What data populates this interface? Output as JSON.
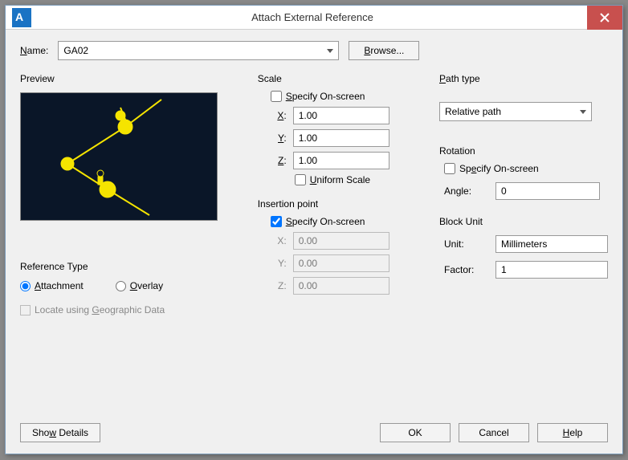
{
  "window": {
    "title": "Attach External Reference"
  },
  "name": {
    "label": "Name:",
    "value": "GA02",
    "browse": "Browse..."
  },
  "preview": {
    "title": "Preview"
  },
  "reference_type": {
    "title": "Reference Type",
    "attachment": "Attachment",
    "overlay": "Overlay"
  },
  "locate_geo": "Locate using Geographic Data",
  "scale": {
    "title": "Scale",
    "specify": "Specify On-screen",
    "x_label": "X:",
    "x": "1.00",
    "y_label": "Y:",
    "y": "1.00",
    "z_label": "Z:",
    "z": "1.00",
    "uniform": "Uniform Scale"
  },
  "insertion": {
    "title": "Insertion point",
    "specify": "Specify On-screen",
    "x_label": "X:",
    "x": "0.00",
    "y_label": "Y:",
    "y": "0.00",
    "z_label": "Z:",
    "z": "0.00"
  },
  "path_type": {
    "title": "Path type",
    "value": "Relative path"
  },
  "rotation": {
    "title": "Rotation",
    "specify": "Specify On-screen",
    "angle_label": "Angle:",
    "angle": "0"
  },
  "block_unit": {
    "title": "Block Unit",
    "unit_label": "Unit:",
    "unit": "Millimeters",
    "factor_label": "Factor:",
    "factor": "1"
  },
  "footer": {
    "show_details": "Show Details",
    "ok": "OK",
    "cancel": "Cancel",
    "help": "Help"
  }
}
